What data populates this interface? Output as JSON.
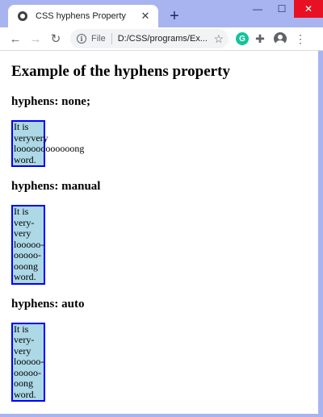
{
  "browser": {
    "tab_title": "CSS hyphens Property",
    "tab_close_glyph": "✕",
    "new_tab_glyph": "+",
    "window_controls": {
      "minimize": "—",
      "maximize": "☐",
      "close": "✕"
    },
    "nav": {
      "back": "←",
      "forward": "→",
      "reload": "↻"
    },
    "omnibox": {
      "info_glyph": "i",
      "scheme_label": "File",
      "url": "D:/CSS/programs/Ex...",
      "star_glyph": "☆"
    },
    "extensions": {
      "grammarly_glyph": "G",
      "puzzle_glyph": "✚",
      "menu_glyph": "⋮"
    },
    "colors": {
      "frame": "#a8b4ef",
      "close_button": "#e81123",
      "grammarly": "#15c39a"
    }
  },
  "page": {
    "heading": "Example of the hyphens property",
    "sections": [
      {
        "heading": "hyphens: none;",
        "lines": [
          "It is",
          "veryvery",
          "loooooooooooong",
          "word."
        ]
      },
      {
        "heading": "hyphens: manual",
        "lines": [
          "It is",
          "very-",
          "very",
          "looooo-",
          "ooooo-",
          "ooong",
          "word."
        ]
      },
      {
        "heading": "hyphens: auto",
        "lines": [
          "It is",
          "very-",
          "very",
          "looooo-",
          "ooooo-",
          "oong",
          "word."
        ]
      }
    ],
    "colors": {
      "box_background": "#add8e6",
      "box_border": "#0000ff"
    }
  }
}
